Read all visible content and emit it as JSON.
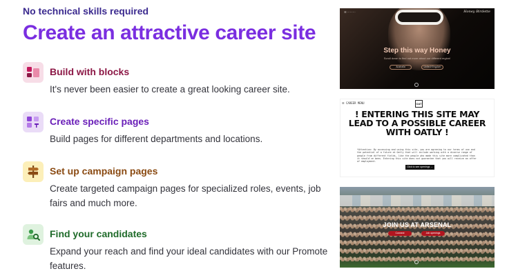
{
  "eyebrow": "No technical skills required",
  "headline": "Create an attractive career site",
  "colors": {
    "headline": "#7a2ee0",
    "eyebrow": "#3b2a8f"
  },
  "features": [
    {
      "icon": "blocks-icon",
      "title": "Build with blocks",
      "desc": "It's never been easier to create a great looking career site."
    },
    {
      "icon": "pages-icon",
      "title": "Create specific pages",
      "desc": "Build pages for different departments and locations."
    },
    {
      "icon": "signpost-icon",
      "title": "Set up campaign pages",
      "desc": "Create targeted campaign pages for specialized roles, events, job fairs and much more."
    },
    {
      "icon": "find-candidates-icon",
      "title": "Find your candidates",
      "desc": "Expand your reach and find your ideal candidates with our Promote features."
    }
  ],
  "examples": {
    "honey": {
      "brand": "Honey Birdette",
      "title": "Step this way Honey",
      "subtitle": "Scroll down to find out more about our different region!",
      "btn1": "Australia",
      "btn2": "United Kingdom"
    },
    "oatly": {
      "menu": "☰ CAREER MENU",
      "logo": "OAT",
      "title": "! ENTERING THIS SITE MAY LEAD TO A POSSIBLE CAREER WITH OATLY !",
      "body": "*Attention: By accessing and using this site, you are agreeing to our terms of use and the potential of a future at Oatly that will include working with a diverse range of people from different fields, like the people who made this site more complicated than it should've been. Entering this site does not guarantee that you will receive an offer of employment.",
      "cta": "Click to see openings →"
    },
    "arsenal": {
      "title": "JOIN US AT ARSENAL",
      "btn1": "Connect",
      "btn2": "Job openings"
    }
  }
}
